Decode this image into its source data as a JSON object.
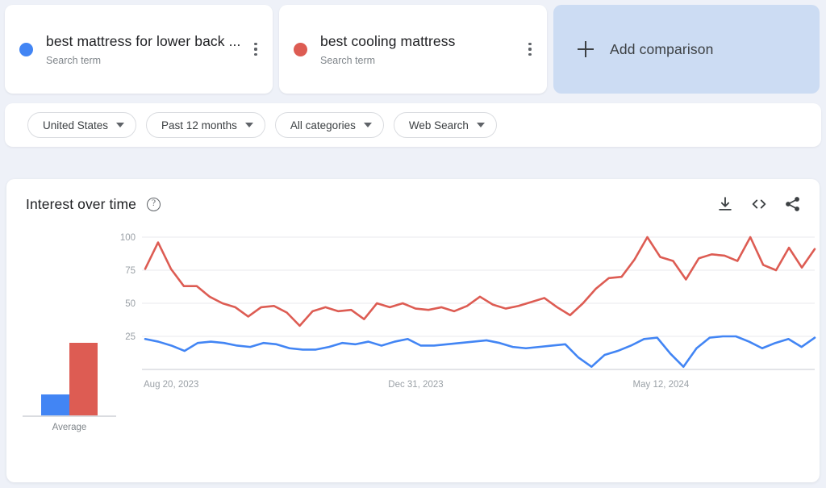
{
  "terms": [
    {
      "name": "best mattress for lower back ...",
      "type": "Search term",
      "color": "#4285f4",
      "menu_icon": "kebab-menu-icon"
    },
    {
      "name": "best cooling mattress",
      "type": "Search term",
      "color": "#dd5c53",
      "menu_icon": "kebab-menu-icon"
    }
  ],
  "add_comparison": {
    "label": "Add comparison",
    "icon": "plus-icon",
    "background": "#ccdcf3"
  },
  "filters": [
    {
      "label": "United States",
      "icon": "chevron-down-icon"
    },
    {
      "label": "Past 12 months",
      "icon": "chevron-down-icon"
    },
    {
      "label": "All categories",
      "icon": "chevron-down-icon"
    },
    {
      "label": "Web Search",
      "icon": "chevron-down-icon"
    }
  ],
  "chart_panel": {
    "title": "Interest over time",
    "help_icon": "question-mark-icon",
    "help_glyph": "?",
    "actions": [
      {
        "name": "download-icon",
        "label": "Download"
      },
      {
        "name": "embed-code-icon",
        "label": "Embed"
      },
      {
        "name": "share-icon",
        "label": "Share"
      }
    ]
  },
  "chart_data": {
    "type": "line",
    "title": "Interest over time",
    "xlabel": "",
    "ylabel": "",
    "ylim": [
      0,
      100
    ],
    "yticks": [
      25,
      50,
      75,
      100
    ],
    "grid": true,
    "legend": "top-cards",
    "xtick_labels": [
      "Aug 20, 2023",
      "Dec 31, 2023",
      "May 12, 2024"
    ],
    "xtick_positions": [
      0,
      19,
      38
    ],
    "n_points": 52,
    "series": [
      {
        "name": "best mattress for lower back ...",
        "color": "#4285f4",
        "average": 18,
        "values": [
          23,
          21,
          18,
          14,
          20,
          21,
          20,
          18,
          17,
          20,
          19,
          16,
          15,
          15,
          17,
          20,
          19,
          21,
          18,
          21,
          23,
          18,
          18,
          19,
          20,
          21,
          22,
          20,
          17,
          16,
          17,
          18,
          19,
          9,
          2,
          11,
          14,
          18,
          23,
          24,
          12,
          2,
          16,
          24,
          25,
          25,
          21,
          16,
          20,
          23,
          17,
          24
        ]
      },
      {
        "name": "best cooling mattress",
        "color": "#dd5c53",
        "average": 60,
        "values": [
          76,
          96,
          76,
          63,
          63,
          55,
          50,
          47,
          40,
          47,
          48,
          43,
          33,
          44,
          47,
          44,
          45,
          38,
          50,
          47,
          50,
          46,
          45,
          47,
          44,
          48,
          55,
          49,
          46,
          48,
          51,
          54,
          47,
          41,
          50,
          61,
          69,
          70,
          83,
          100,
          85,
          82,
          68,
          84,
          87,
          86,
          82,
          100,
          79,
          75,
          92,
          77,
          91
        ]
      }
    ],
    "average_bars": {
      "label": "Average",
      "values": [
        18,
        60
      ]
    }
  }
}
